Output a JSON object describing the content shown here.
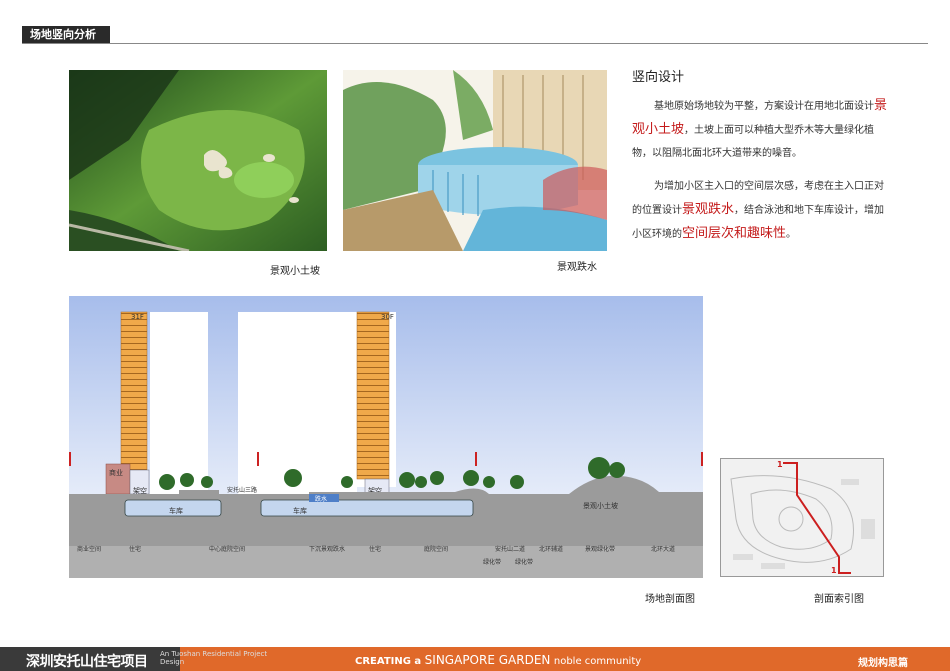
{
  "page": {
    "title": "场地竖向分析"
  },
  "photos": {
    "caption_1": "景观小土坡",
    "caption_2": "景观跌水"
  },
  "design": {
    "heading": "竖向设计",
    "para1": {
      "part1": "基地原始场地较为平整，方案设计在用地北面设计",
      "highlight": "景观小土坡",
      "part2": "，土坡上面可以种植大型乔木等大量绿化植物，以阻隔北面北环大道带来的噪音。"
    },
    "para2": {
      "part1": "为增加小区主入口的空间层次感，考虑在主入口正对的位置设计",
      "highlight1": "景观跌水",
      "part2": "，结合泳池和地下车库设计，增加小区环境的",
      "highlight2": "空间层次和趣味性",
      "part3": "。"
    }
  },
  "section": {
    "floor_label_1": "31F",
    "floor_label_2": "30F",
    "label_commercial": "商业",
    "label_stilt_1": "架空",
    "label_stilt_2": "架空",
    "label_road_sign": "安托山三路",
    "label_waterfall": "跌水",
    "label_garage_1": "车库",
    "label_garage_2": "车库",
    "label_mound": "景观小土坡",
    "zones": [
      "商业空间",
      "住宅",
      "中心庭院空间",
      "下沉景观跌水",
      "住宅",
      "庭院空间",
      "安托山二道",
      "北环辅道",
      "景观绿化带",
      "北环大道"
    ],
    "sub_zones": [
      "绿化带",
      "绿化带"
    ],
    "caption": "场地剖面图"
  },
  "index_map": {
    "marker_top": "1",
    "marker_bottom": "1",
    "caption": "剖面索引图"
  },
  "footer": {
    "project_name": "深圳安托山住宅项目",
    "project_en": "An Tuoshan Residential Project Design",
    "tag_pre": "CREATING a",
    "tag_big": "SINGAPORE GARDEN",
    "tag_post": "noble community",
    "chapter": "规划构思篇"
  },
  "colors": {
    "accent_red": "#c41b1b",
    "footer_orange": "#e0692a",
    "building_orange": "#f0a94a"
  }
}
